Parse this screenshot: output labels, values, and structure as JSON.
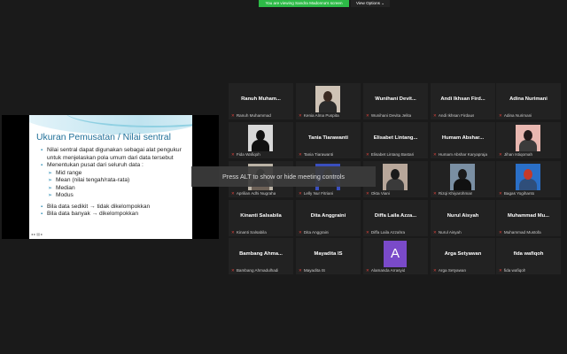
{
  "top_bar": {
    "viewing_label": "You are viewing Sandra Madonna's screen",
    "view_options_label": "View Options ⌄"
  },
  "slide": {
    "title": "Ukuran Pemusatan / Nilai sentral",
    "bullets": [
      "Nilai sentral dapat digunakan sebagai alat pengukur untuk menjelaskan pola umum dari data tersebut",
      "Menentukan pusat dari seluruh data :",
      "Bila data sedikit → tidak dikelompokkan",
      "Bila data banyak → dikelompokkan"
    ],
    "sub_bullets": [
      "Mid range",
      "Mean (nilai tengah/rata-rata)",
      "Median",
      "Modus"
    ],
    "controls": "◂ ▸ ▤ ▸"
  },
  "toast": "Press ALT to show or hide meeting controls",
  "participants": [
    {
      "name": "Ranuh Muham...",
      "caption": "Ranuh Muhammad"
    },
    {
      "name": "",
      "caption": "Kenia Alma Puspita"
    },
    {
      "name": "Wunihani Devit...",
      "caption": "Wunihani Devita Jelita"
    },
    {
      "name": "Andi Ikhsan Fird...",
      "caption": "Andi Ikhsan Firdaus"
    },
    {
      "name": "Adina Nurimani",
      "caption": "Adina Nurimani"
    },
    {
      "name": "",
      "caption": "Fida Wafiqoh"
    },
    {
      "name": "Tania Tiarawanti",
      "caption": "Tania Tiarawanti"
    },
    {
      "name": "Elisabet Lintang...",
      "caption": "Elisabet Lintang Bastari"
    },
    {
      "name": "Humam Abshar...",
      "caption": "Humam Abshar Karyapraja"
    },
    {
      "name": "",
      "caption": "Jihan Istiqomah"
    },
    {
      "name": "",
      "caption": "Aprilian Adhi Nugraha"
    },
    {
      "name": "",
      "caption": "Lelly Nur Fitriani"
    },
    {
      "name": "",
      "caption": "Okta Viani"
    },
    {
      "name": "",
      "caption": "Rizqi Khiyarohman"
    },
    {
      "name": "",
      "caption": "Bagas Yogihanto"
    },
    {
      "name": "Kinanti Salsabila",
      "caption": "Kinanti Salsabila"
    },
    {
      "name": "Dita Anggraini",
      "caption": "Dita Anggraini"
    },
    {
      "name": "Diffa Laila Azza...",
      "caption": "Diffa Laila Azzahra"
    },
    {
      "name": "Nurul Aisyah",
      "caption": "Nurul Aisyah"
    },
    {
      "name": "Muhammad Mu...",
      "caption": "Muhammad Mustofa"
    },
    {
      "name": "Bambang Ahma...",
      "caption": "Bambang Ahmadulhadi"
    },
    {
      "name": "Mayadita IS",
      "caption": "Mayadita IS"
    },
    {
      "name": "",
      "caption": "Alamanda Arrasyid",
      "avatar_letter": "A"
    },
    {
      "name": "Arga Setyawan",
      "caption": "Arga Setyawan"
    },
    {
      "name": "fida wafiqoh",
      "caption": "fida wafiqoh"
    }
  ]
}
